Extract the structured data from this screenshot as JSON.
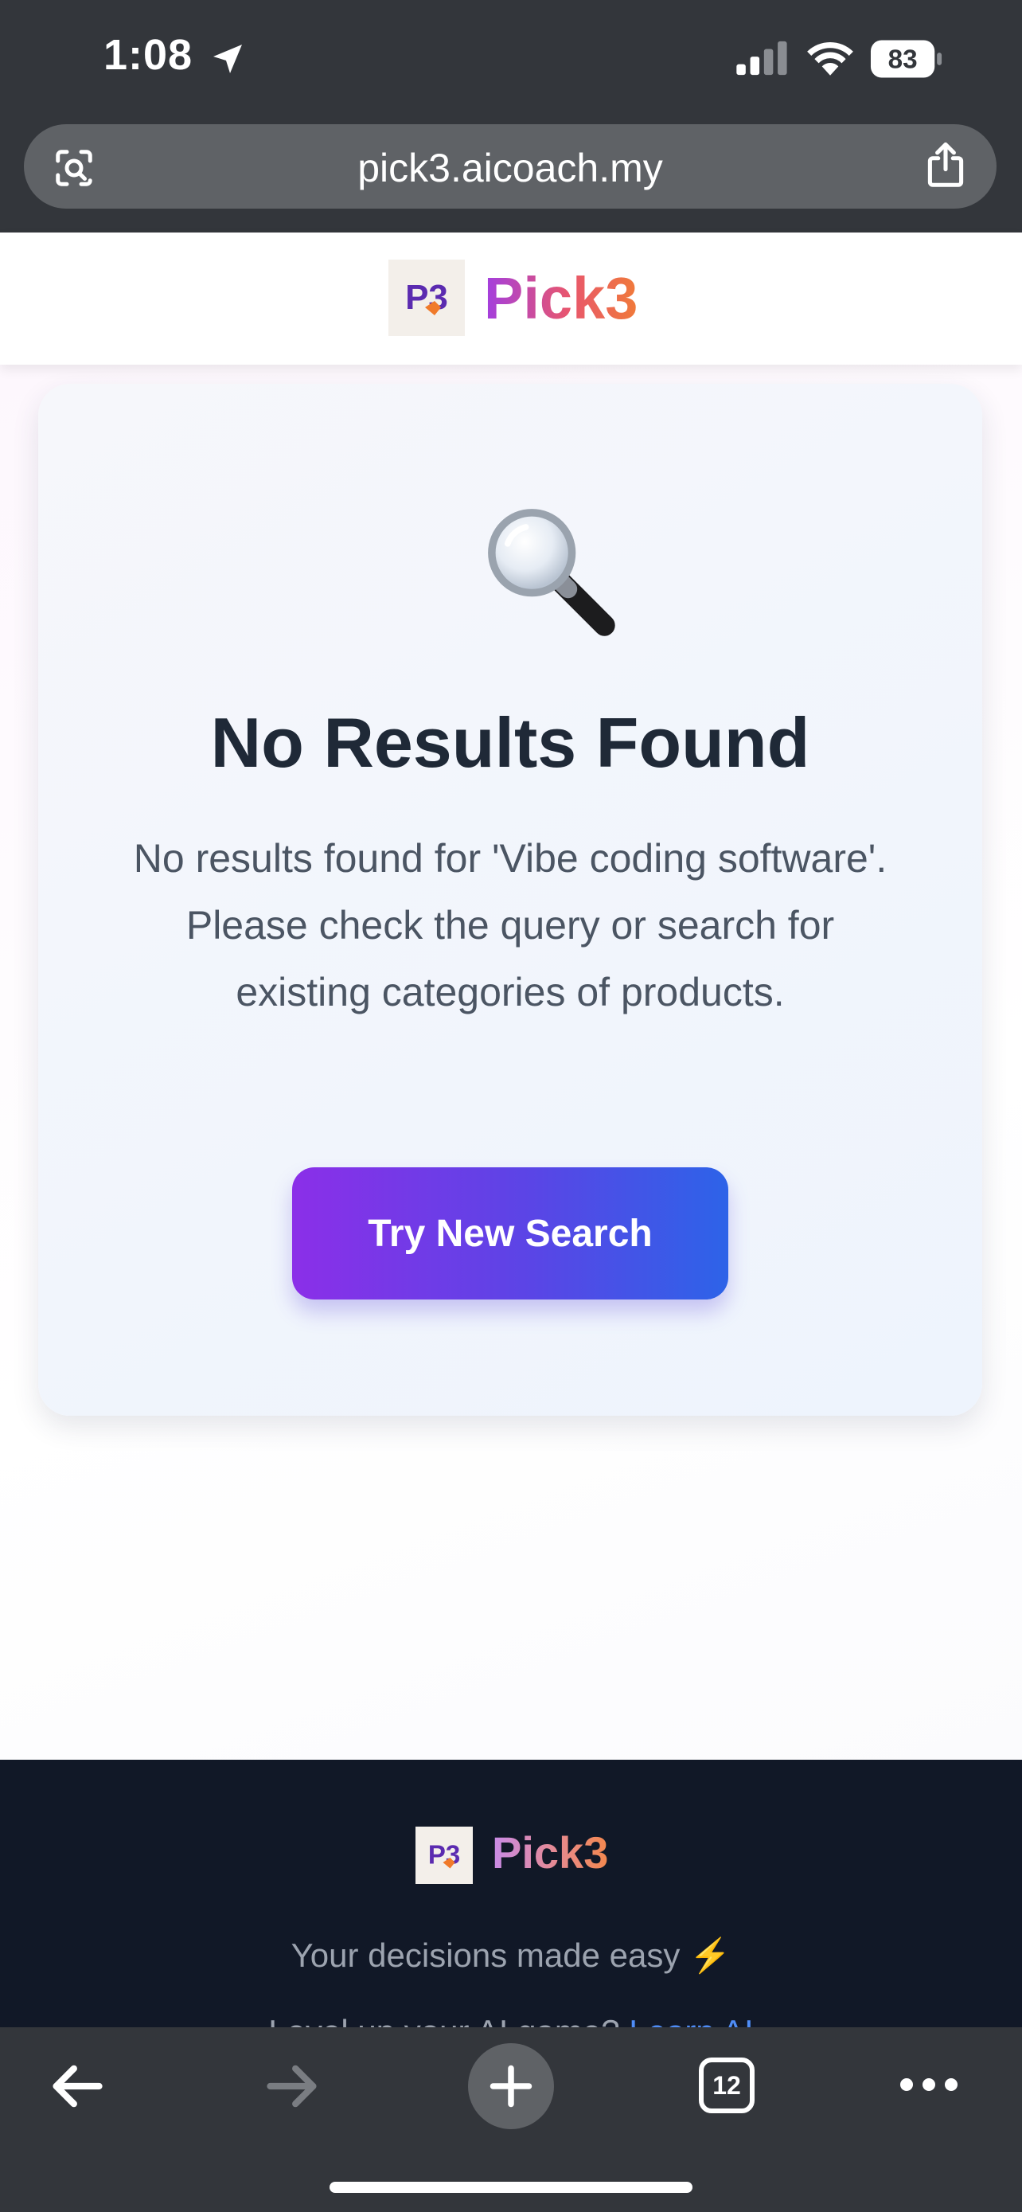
{
  "status_bar": {
    "time": "1:08",
    "battery": "83",
    "icons": [
      "location-arrow-icon",
      "cellular-signal-icon",
      "wifi-icon",
      "battery-icon"
    ]
  },
  "browser": {
    "url": "pick3.aicoach.my",
    "left_icon": "visual-search-icon",
    "right_icon": "share-icon"
  },
  "site_header": {
    "brand": "Pick3",
    "logo_text": "P3"
  },
  "no_results": {
    "icon": "magnifying-glass-icon",
    "title": "No Results Found",
    "message": "No results found for 'Vibe coding software'. Please check the query or search for existing categories of products.",
    "cta_label": "Try New Search"
  },
  "footer": {
    "brand": "Pick3",
    "tagline": "Your decisions made easy",
    "tagline_emoji": "⚡",
    "learn_prefix": "Level up your AI game?",
    "learn_link": "Learn AI"
  },
  "toolbar": {
    "tab_count": "12",
    "icons": [
      "back-arrow-icon",
      "forward-arrow-icon",
      "new-tab-plus-icon",
      "tabs-icon",
      "more-icon"
    ]
  },
  "colors": {
    "chrome": "#33363b",
    "urlbar": "#5f6266",
    "footer": "#111827",
    "title": "#1f2937",
    "body_text": "#4b5563",
    "cta_start": "#8b2fe8",
    "cta_end": "#2d63e8",
    "link": "#4f8df7"
  }
}
